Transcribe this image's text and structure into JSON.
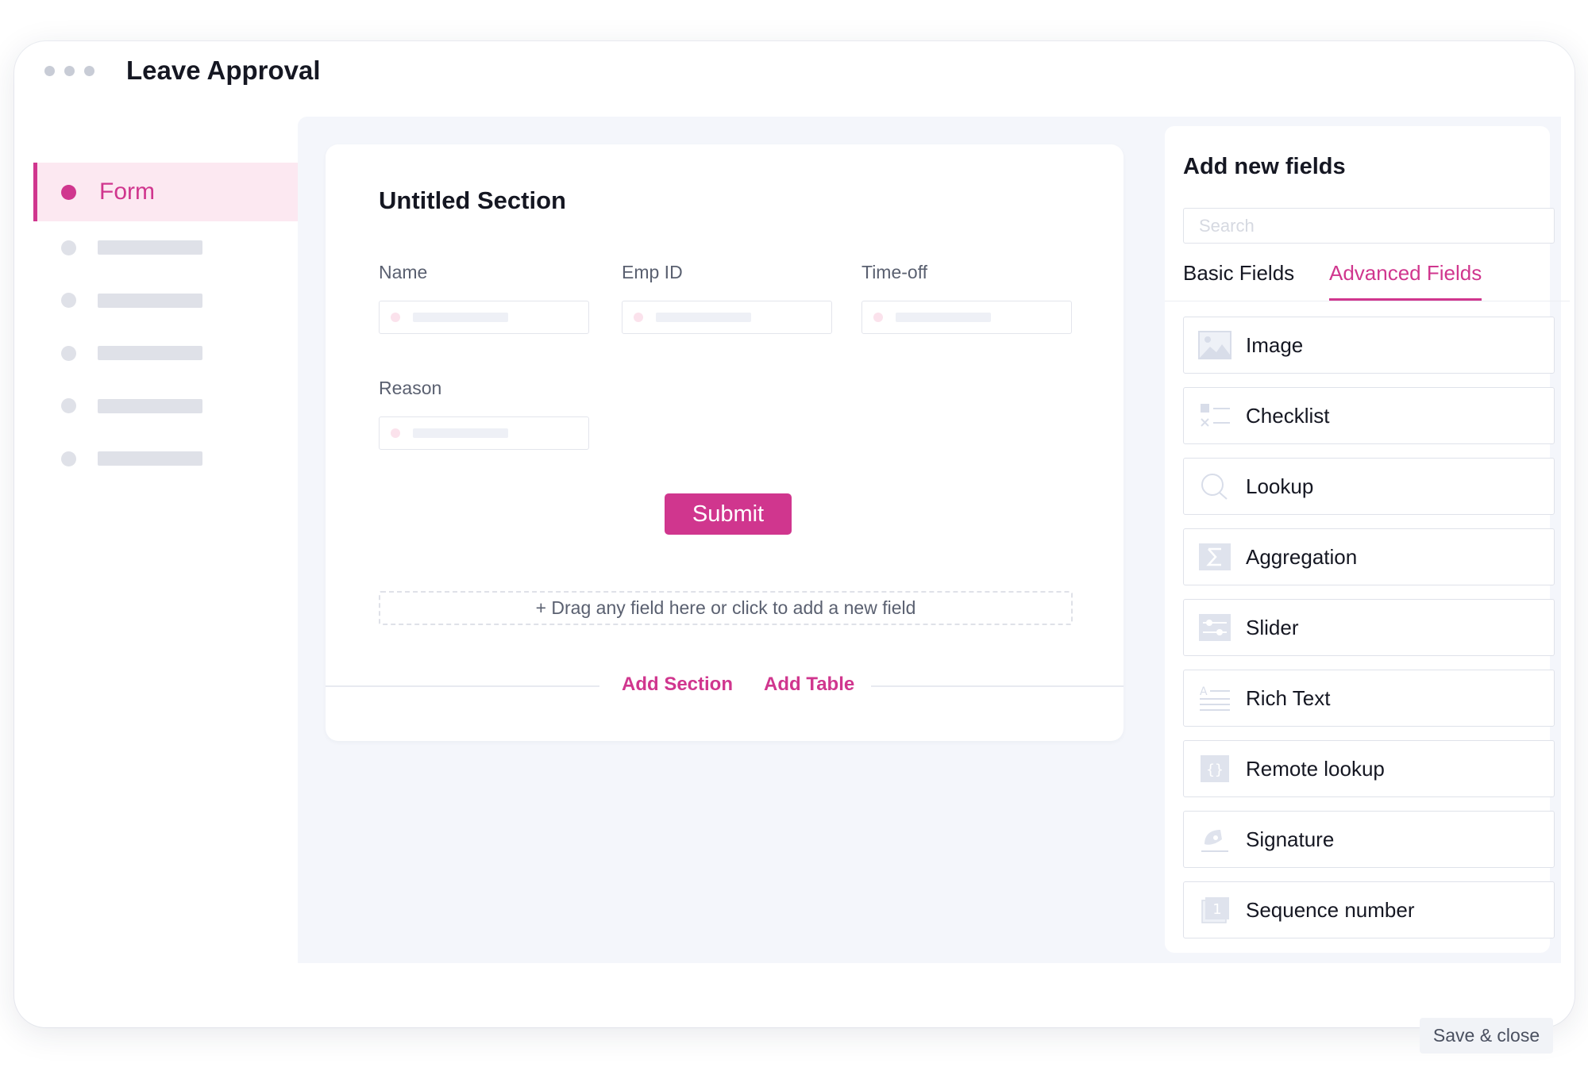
{
  "window": {
    "title": "Leave Approval"
  },
  "nav": {
    "active_label": "Form"
  },
  "form": {
    "section_title": "Untitled Section",
    "fields": {
      "name": "Name",
      "emp_id": "Emp ID",
      "time_off": "Time-off",
      "reason": "Reason"
    },
    "submit_label": "Submit",
    "dropzone_text": "+ Drag any field here or click to add a new field",
    "add_section_label": "Add Section",
    "add_table_label": "Add Table"
  },
  "panel": {
    "title": "Add new fields",
    "search_placeholder": "Search",
    "tabs": {
      "basic": "Basic Fields",
      "advanced": "Advanced Fields"
    },
    "active_tab": "advanced",
    "items": [
      {
        "label": "Image",
        "icon": "image-icon"
      },
      {
        "label": "Checklist",
        "icon": "checklist-icon"
      },
      {
        "label": "Lookup",
        "icon": "lookup-icon"
      },
      {
        "label": "Aggregation",
        "icon": "sigma-icon"
      },
      {
        "label": "Slider",
        "icon": "slider-icon"
      },
      {
        "label": "Rich Text",
        "icon": "rich-text-icon"
      },
      {
        "label": "Remote lookup",
        "icon": "braces-icon"
      },
      {
        "label": "Signature",
        "icon": "signature-icon"
      },
      {
        "label": "Sequence number",
        "icon": "sequence-icon"
      }
    ]
  },
  "footer": {
    "save_close_label": "Save & close"
  },
  "colors": {
    "accent": "#d0368e",
    "accent_light": "#fce8f1",
    "canvas_bg": "#f4f6fb",
    "icon_tint": "#d8dde9"
  }
}
